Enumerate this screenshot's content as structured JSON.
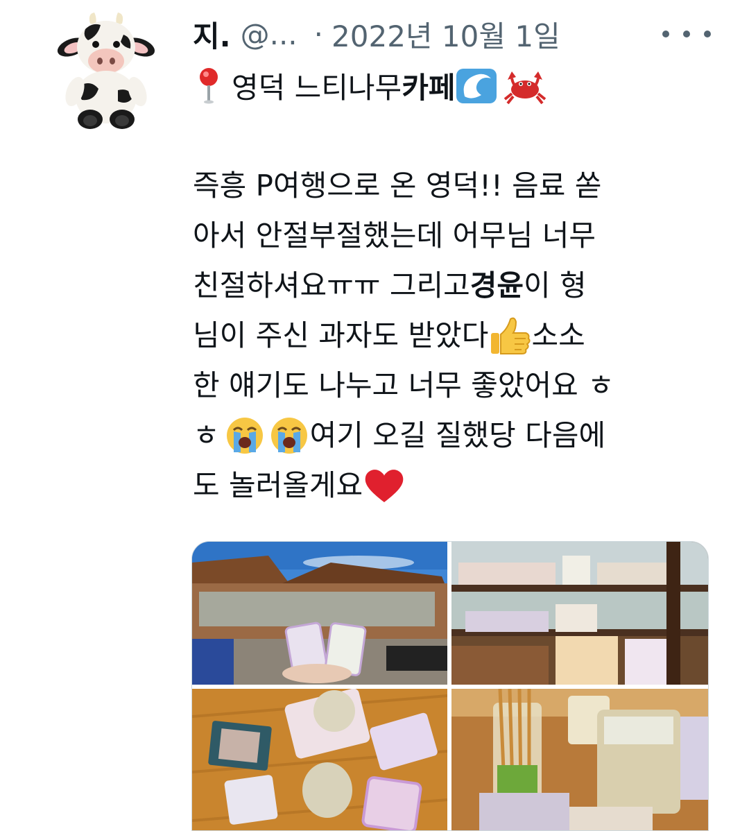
{
  "tweet": {
    "display_name": "지.",
    "handle": "@...",
    "separator": "·",
    "date": "2022년 10월 1일",
    "title": {
      "before": "영덕 느티나무 ",
      "bold": "카페"
    },
    "body_lines": [
      {
        "text": "즉흥 P여행으로 온 영덕!! 음료 쏟"
      },
      {
        "text": "아서 안절부절했는데 어무님 너무"
      },
      {
        "pre": "친절하셔요ㅠㅠ 그리고 ",
        "bold": "경윤",
        "post": "이 형"
      },
      {
        "text": "님이 주신 과자도 받았다",
        "after": " 소소"
      },
      {
        "text": "한 얘기도 나누고 너무 좋았어요 ㅎ"
      },
      {
        "pre": "ㅎ ",
        "post": " 여기 오길 질했당 다음에"
      },
      {
        "text": "도 놀러올게요"
      }
    ]
  },
  "icons": {
    "pin": "round-pushpin-icon",
    "wave": "water-wave-icon",
    "crab": "crab-icon",
    "thumb": "thumbs-up-icon",
    "cry": "loudly-crying-face-icon",
    "heart": "red-heart-icon",
    "more": "more-options-icon"
  },
  "media": {
    "photos": [
      "cafe-exterior-photo",
      "cafe-interior-shelf-photo",
      "table-drinks-photo",
      "drinks-closeup-photo"
    ]
  }
}
